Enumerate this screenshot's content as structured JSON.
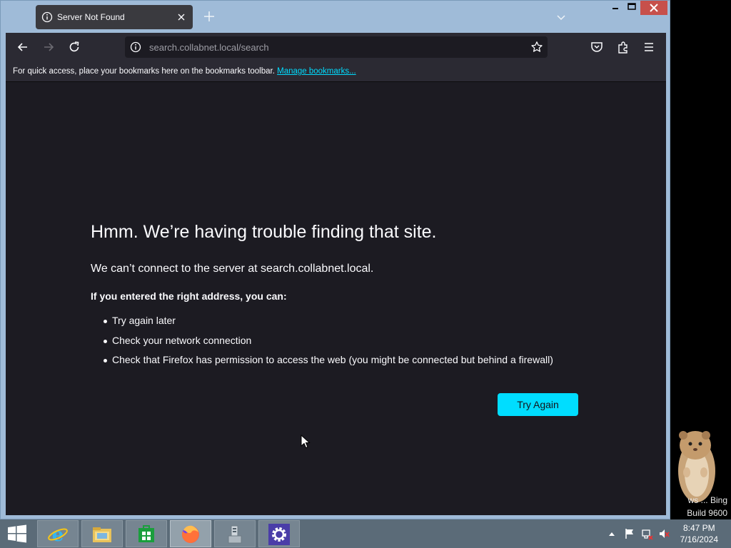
{
  "browser": {
    "tab_title": "Server Not Found",
    "url_host": "search.collabnet.local",
    "url_path": "/search",
    "bookmarks_prompt": "For quick access, place your bookmarks here on the bookmarks toolbar.",
    "manage_bookmarks": "Manage bookmarks..."
  },
  "error_page": {
    "title": "Hmm. We’re having trouble finding that site.",
    "message": "We can’t connect to the server at search.collabnet.local.",
    "subtitle": "If you entered the right address, you can:",
    "suggestions": [
      "Try again later",
      "Check your network connection",
      "Check that Firefox has permission to access the web (you might be connected but behind a firewall)"
    ],
    "try_again_label": "Try Again",
    "accent_color": "#00ddff"
  },
  "desktop": {
    "watermark_line1": "ws ... Bing",
    "watermark_line2": "Build 9600"
  },
  "taskbar": {
    "apps": [
      "internet-explorer",
      "file-explorer",
      "store",
      "firefox",
      "server-manager",
      "settings"
    ],
    "active_app": "firefox",
    "clock_time": "8:47 PM",
    "clock_date": "7/16/2024"
  }
}
